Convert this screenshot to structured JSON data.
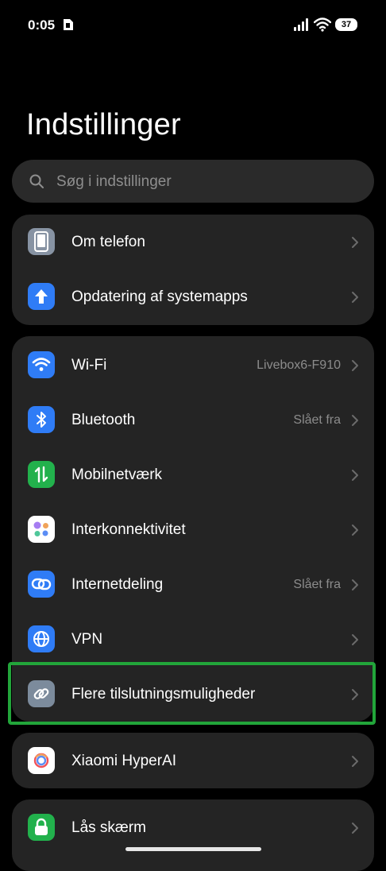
{
  "status_bar": {
    "time": "0:05",
    "battery": "37"
  },
  "header": {
    "title": "Indstillinger"
  },
  "search": {
    "placeholder": "Søg i indstillinger"
  },
  "groups": {
    "system": {
      "items": [
        {
          "label": "Om telefon",
          "value": "",
          "icon": "phone-icon"
        },
        {
          "label": "Opdatering af systemapps",
          "value": "",
          "icon": "arrow-up-icon"
        }
      ]
    },
    "connectivity": {
      "items": [
        {
          "label": "Wi-Fi",
          "value": "Livebox6-F910",
          "icon": "wifi-icon"
        },
        {
          "label": "Bluetooth",
          "value": "Slået fra",
          "icon": "bluetooth-icon"
        },
        {
          "label": "Mobilnetværk",
          "value": "",
          "icon": "mobile-data-icon"
        },
        {
          "label": "Interkonnektivitet",
          "value": "",
          "icon": "interconnectivity-icon"
        },
        {
          "label": "Internetdeling",
          "value": "Slået fra",
          "icon": "hotspot-icon"
        },
        {
          "label": "VPN",
          "value": "",
          "icon": "globe-icon"
        },
        {
          "label": "Flere tilslutningsmuligheder",
          "value": "",
          "icon": "link-icon"
        }
      ]
    },
    "ai": {
      "items": [
        {
          "label": "Xiaomi HyperAI",
          "value": "",
          "icon": "hyperai-icon"
        }
      ]
    },
    "lock": {
      "items": [
        {
          "label": "Lås skærm",
          "value": "",
          "icon": "lock-icon"
        }
      ]
    }
  },
  "colors": {
    "background": "#000000",
    "card": "#242424",
    "highlight": "#22a53a",
    "blue": "#2f7cf6",
    "green": "#22b14c",
    "grey": "#7c8b9c"
  }
}
